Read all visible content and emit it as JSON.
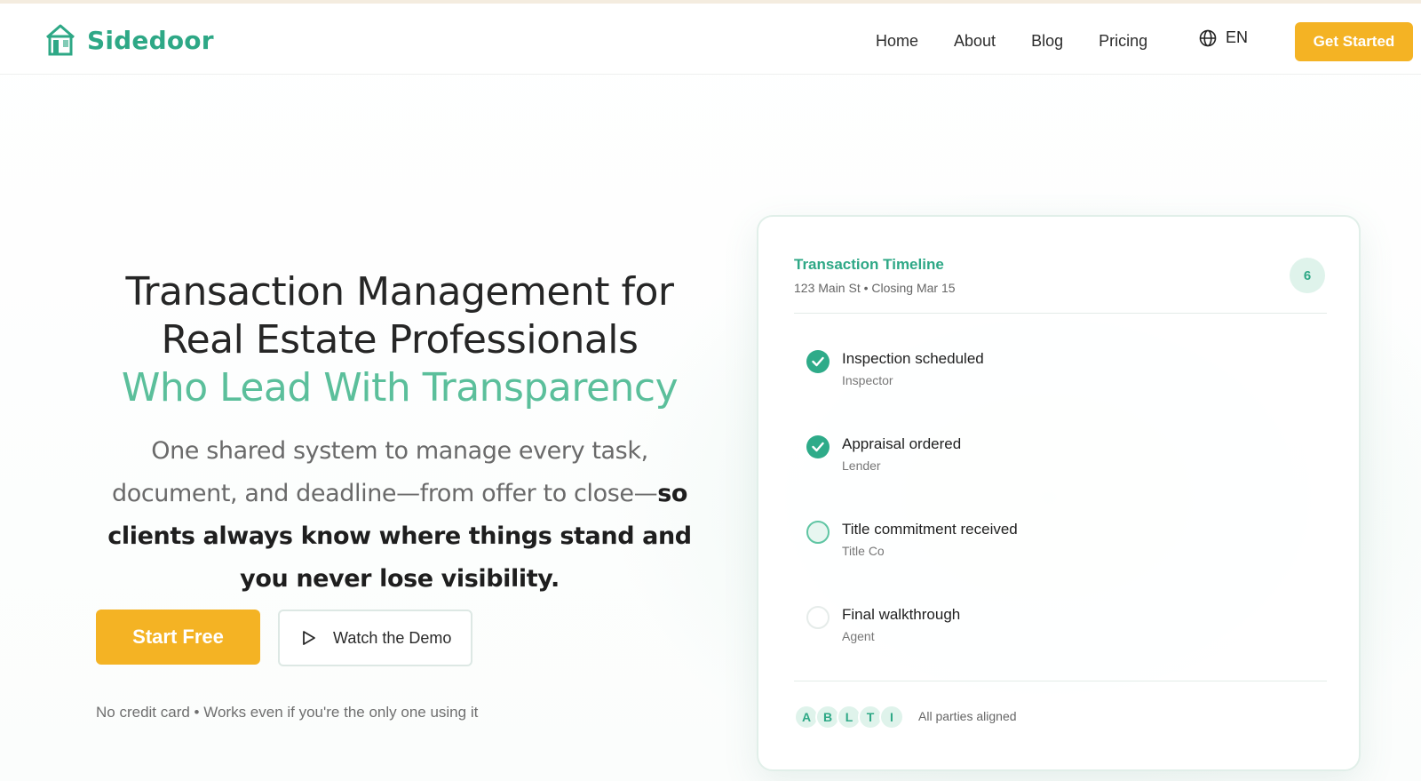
{
  "brand": {
    "name": "Sidedoor",
    "accent": "#2ea886",
    "cta_color": "#f4b324"
  },
  "nav": {
    "items": [
      "Home",
      "About",
      "Blog",
      "Pricing"
    ],
    "language": "EN",
    "cta": "Get Started"
  },
  "hero": {
    "title_line1": "Transaction Management for",
    "title_line2": "Real Estate Professionals",
    "title_accent": "Who Lead With Transparency",
    "subtitle_plain": "One shared system to manage every task, document, and deadline—from offer to close—",
    "subtitle_bold": "so clients always know where things stand and you never lose visibility.",
    "primary_button": "Start Free",
    "secondary_button": "Watch the Demo",
    "fineprint": "No credit card • Works even if you're the only one using it"
  },
  "card": {
    "title": "Transaction Timeline",
    "subtitle": "123 Main St • Closing Mar 15",
    "count": "6",
    "tasks": [
      {
        "name": "Inspection scheduled",
        "role": "Inspector",
        "status": "done"
      },
      {
        "name": "Appraisal ordered",
        "role": "Lender",
        "status": "done"
      },
      {
        "name": "Title commitment received",
        "role": "Title Co",
        "status": "in-progress"
      },
      {
        "name": "Final walkthrough",
        "role": "Agent",
        "status": "pending"
      }
    ],
    "avatars": [
      "A",
      "B",
      "L",
      "T",
      "I"
    ],
    "footer_text": "All parties aligned"
  }
}
